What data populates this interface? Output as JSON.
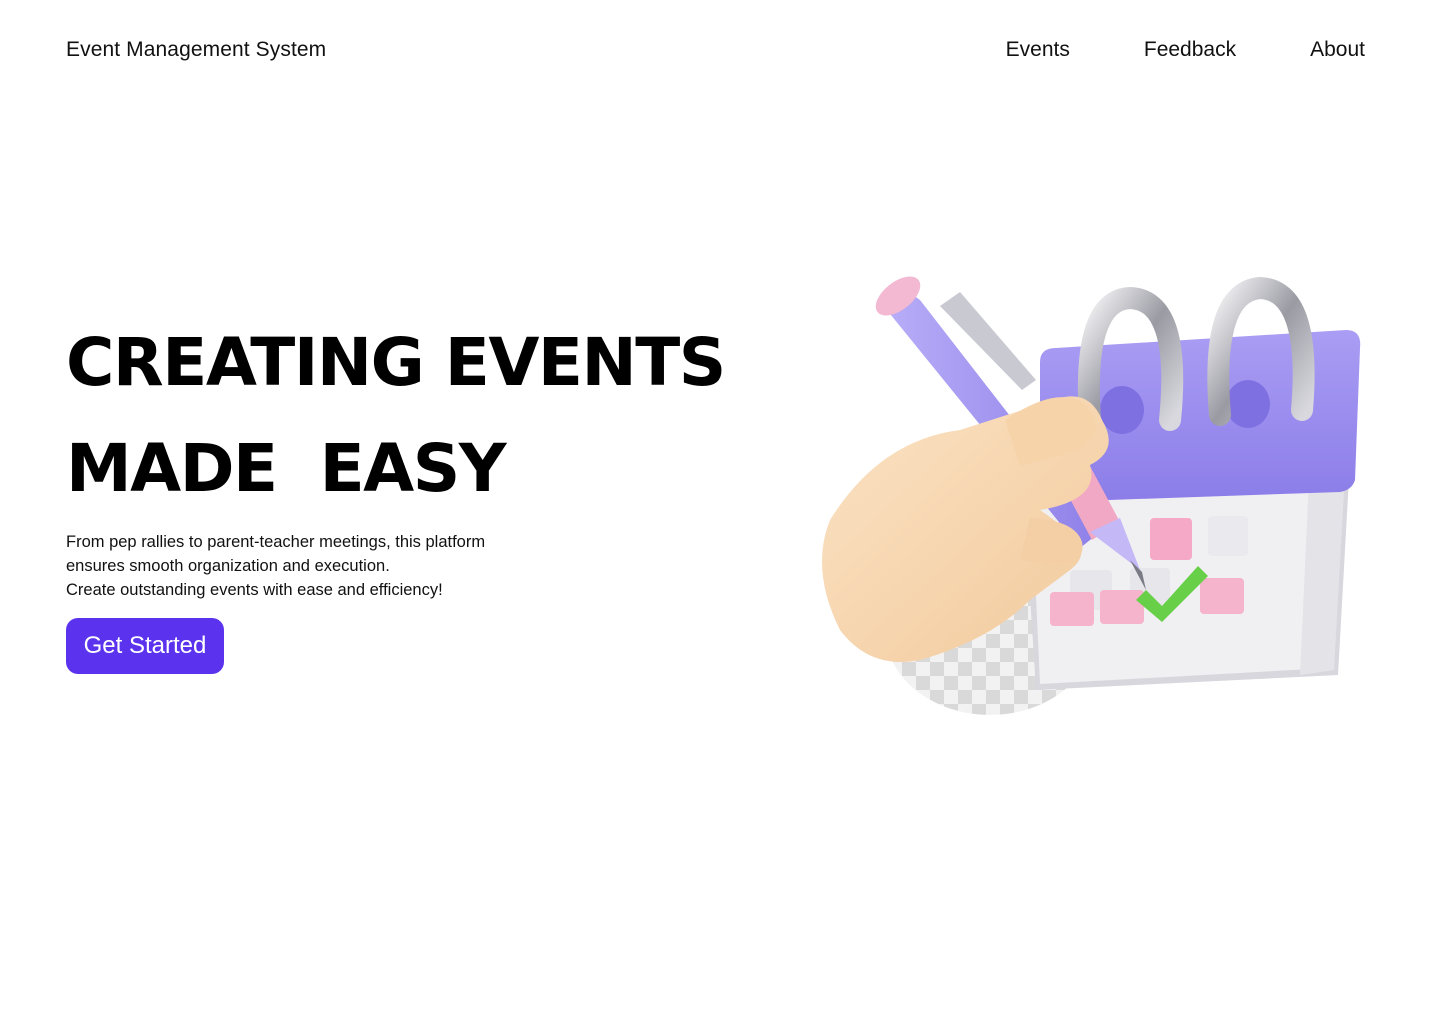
{
  "header": {
    "brand": "Event Management System",
    "nav": [
      "Events",
      "Feedback",
      "About"
    ]
  },
  "hero": {
    "title_line1": "CREATING EVENTS",
    "title_line2": "MADE  EASY",
    "description": [
      "From pep rallies to parent-teacher meetings, this platform",
      "ensures smooth organization and execution.",
      "Create outstanding events with ease and efficiency!"
    ],
    "cta_label": "Get Started"
  },
  "illustration": {
    "subject": "3d-hand-pen-calendar-icon"
  },
  "colors": {
    "accent": "#5b33ee",
    "calendar_purple": "#9b8df0",
    "pen_purple": "#a79af2",
    "pink": "#f2a9c4",
    "green_check": "#6ad04a",
    "skin": "#f7d6b0"
  }
}
